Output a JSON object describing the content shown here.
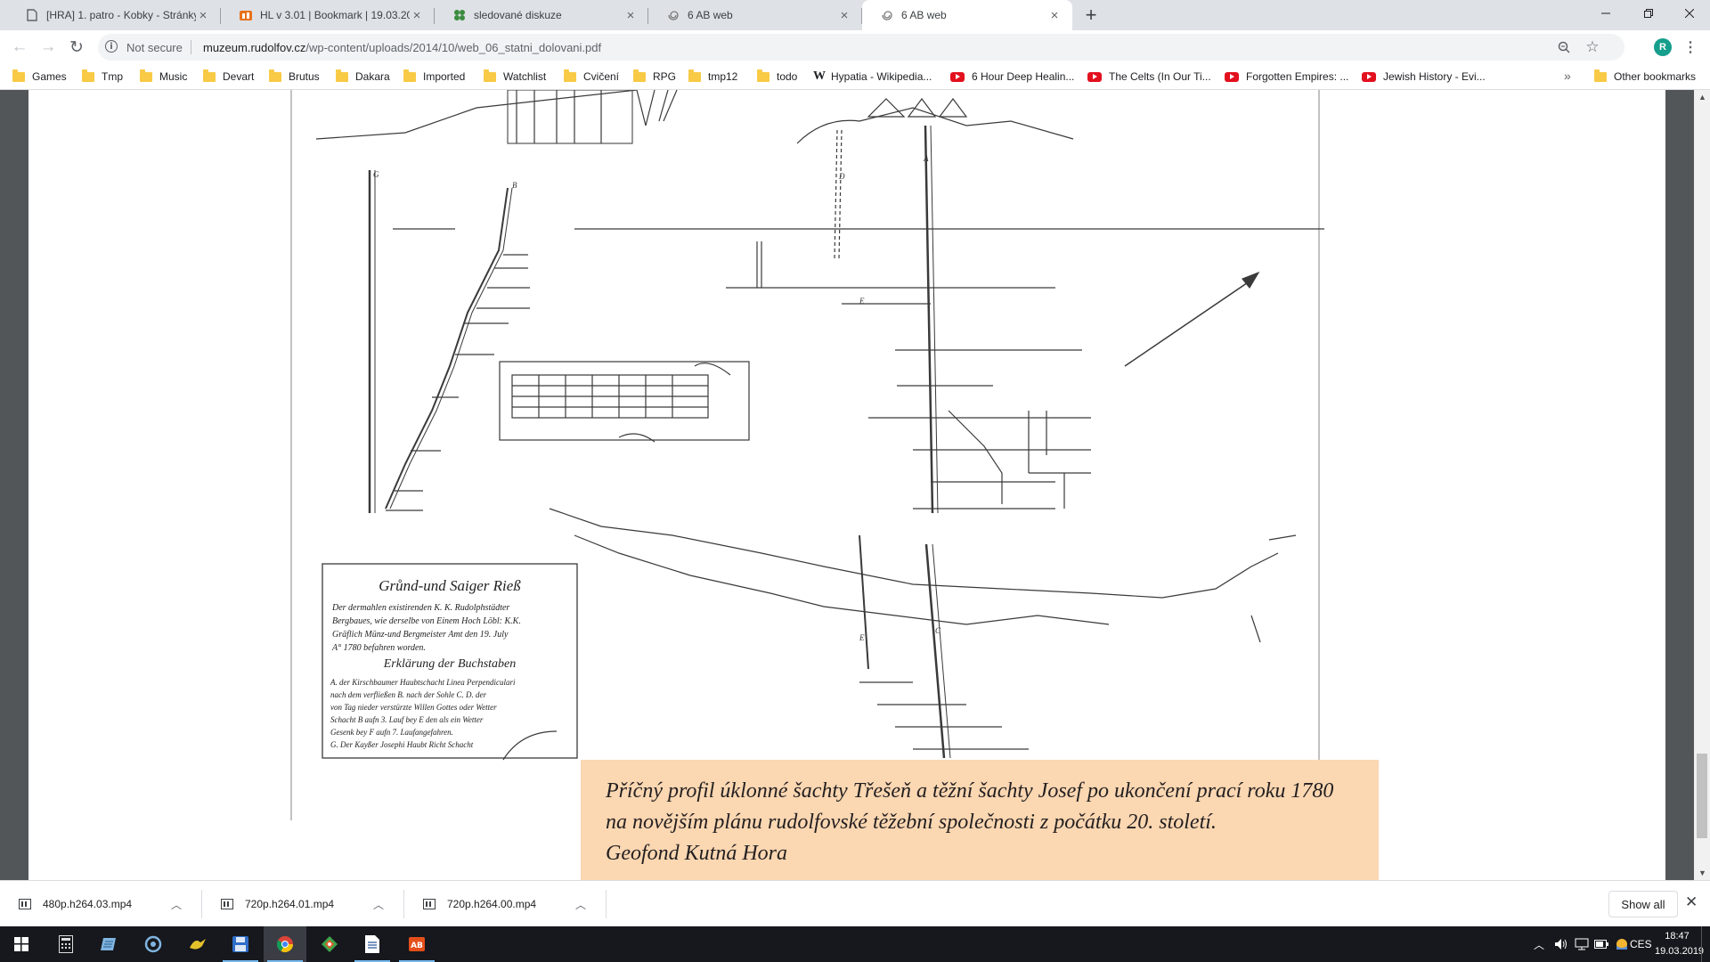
{
  "tabs": [
    {
      "title": "[HRA] 1. patro - Kobky - Stránky",
      "icon": "page-icon"
    },
    {
      "title": "HL v 3.01 | Bookmark | 19.03.2019",
      "icon": "site-logo-icon"
    },
    {
      "title": "sledované diskuze",
      "icon": "forum-icon"
    },
    {
      "title": "6 AB web",
      "icon": "spiral-icon"
    },
    {
      "title": "6 AB web",
      "icon": "spiral-icon",
      "active": true
    }
  ],
  "toolbar": {
    "security_label": "Not secure",
    "url_host": "muzeum.rudolfov.cz",
    "url_path": "/wp-content/uploads/2014/10/web_06_statni_dolovani.pdf",
    "profile_initial": "R"
  },
  "bookmarks": [
    {
      "label": "Games",
      "type": "folder"
    },
    {
      "label": "Tmp",
      "type": "folder"
    },
    {
      "label": "Music",
      "type": "folder"
    },
    {
      "label": "Devart",
      "type": "folder"
    },
    {
      "label": "Brutus",
      "type": "folder"
    },
    {
      "label": "Dakara",
      "type": "folder"
    },
    {
      "label": "Imported",
      "type": "folder"
    },
    {
      "label": "Watchlist",
      "type": "folder"
    },
    {
      "label": "Cvičení",
      "type": "folder"
    },
    {
      "label": "RPG",
      "type": "folder"
    },
    {
      "label": "tmp12",
      "type": "folder"
    },
    {
      "label": "todo",
      "type": "folder"
    },
    {
      "label": "Hypatia - Wikipedia...",
      "type": "wikipedia"
    },
    {
      "label": "6 Hour Deep Healin...",
      "type": "youtube"
    },
    {
      "label": "The Celts (In Our Ti...",
      "type": "youtube"
    },
    {
      "label": "Forgotten Empires: ...",
      "type": "youtube"
    },
    {
      "label": "Jewish History - Evi...",
      "type": "youtube"
    }
  ],
  "bookmarks_overflow": "»",
  "other_bookmarks": "Other bookmarks",
  "document": {
    "legend_title": "Grůnd-und Saiger Rieß",
    "legend_text_1": "Der dermahlen existirenden K. K. Rudolphstädter",
    "legend_text_2": "Bergbaues, wie derselbe von Einem Hoch Löbl: K.K.",
    "legend_text_3": "Gräflich Münz-und Bergmeister Amt den 19. July",
    "legend_text_4": "A° 1780 befahren worden.",
    "legend_subtitle": "Erklärung der Buchstaben",
    "legend_text_5": "A. der Kirschbaumer Haubtschacht Linea Perpendiculari",
    "legend_text_6": "nach dem verfließen B. nach der Sohle C. D. der",
    "legend_text_7": "von Tag nieder verstürzte Willen Gottes oder Wetter",
    "legend_text_8": "Schacht B aufn 3. Lauf bey E den als ein Wetter",
    "legend_text_9": "Gesenk bey F aufn 7. Laufangefahren.",
    "legend_text_10": "G. Der Kayßer Josephi Haubt Richt Schacht",
    "caption_line_1": "Příčný profil úklonné šachty Třešeň a těžní šachty Josef po ukončení prací roku 1780",
    "caption_line_2": "na novějším plánu rudolfovské těžební společnosti z počátku 20. století.",
    "caption_line_3": "Geofond Kutná Hora"
  },
  "downloads": [
    {
      "name": "480p.h264.03.mp4"
    },
    {
      "name": "720p.h264.01.mp4"
    },
    {
      "name": "720p.h264.00.mp4"
    }
  ],
  "show_all_label": "Show all",
  "taskbar": {
    "language": "CES",
    "time": "18:47",
    "date": "19.03.2019"
  },
  "colors": {
    "caption_bg": "#fbd7b2",
    "tabstrip_bg": "#dee1e6",
    "taskbar_bg": "#16181d",
    "pdf_viewer_bg": "#525659"
  }
}
